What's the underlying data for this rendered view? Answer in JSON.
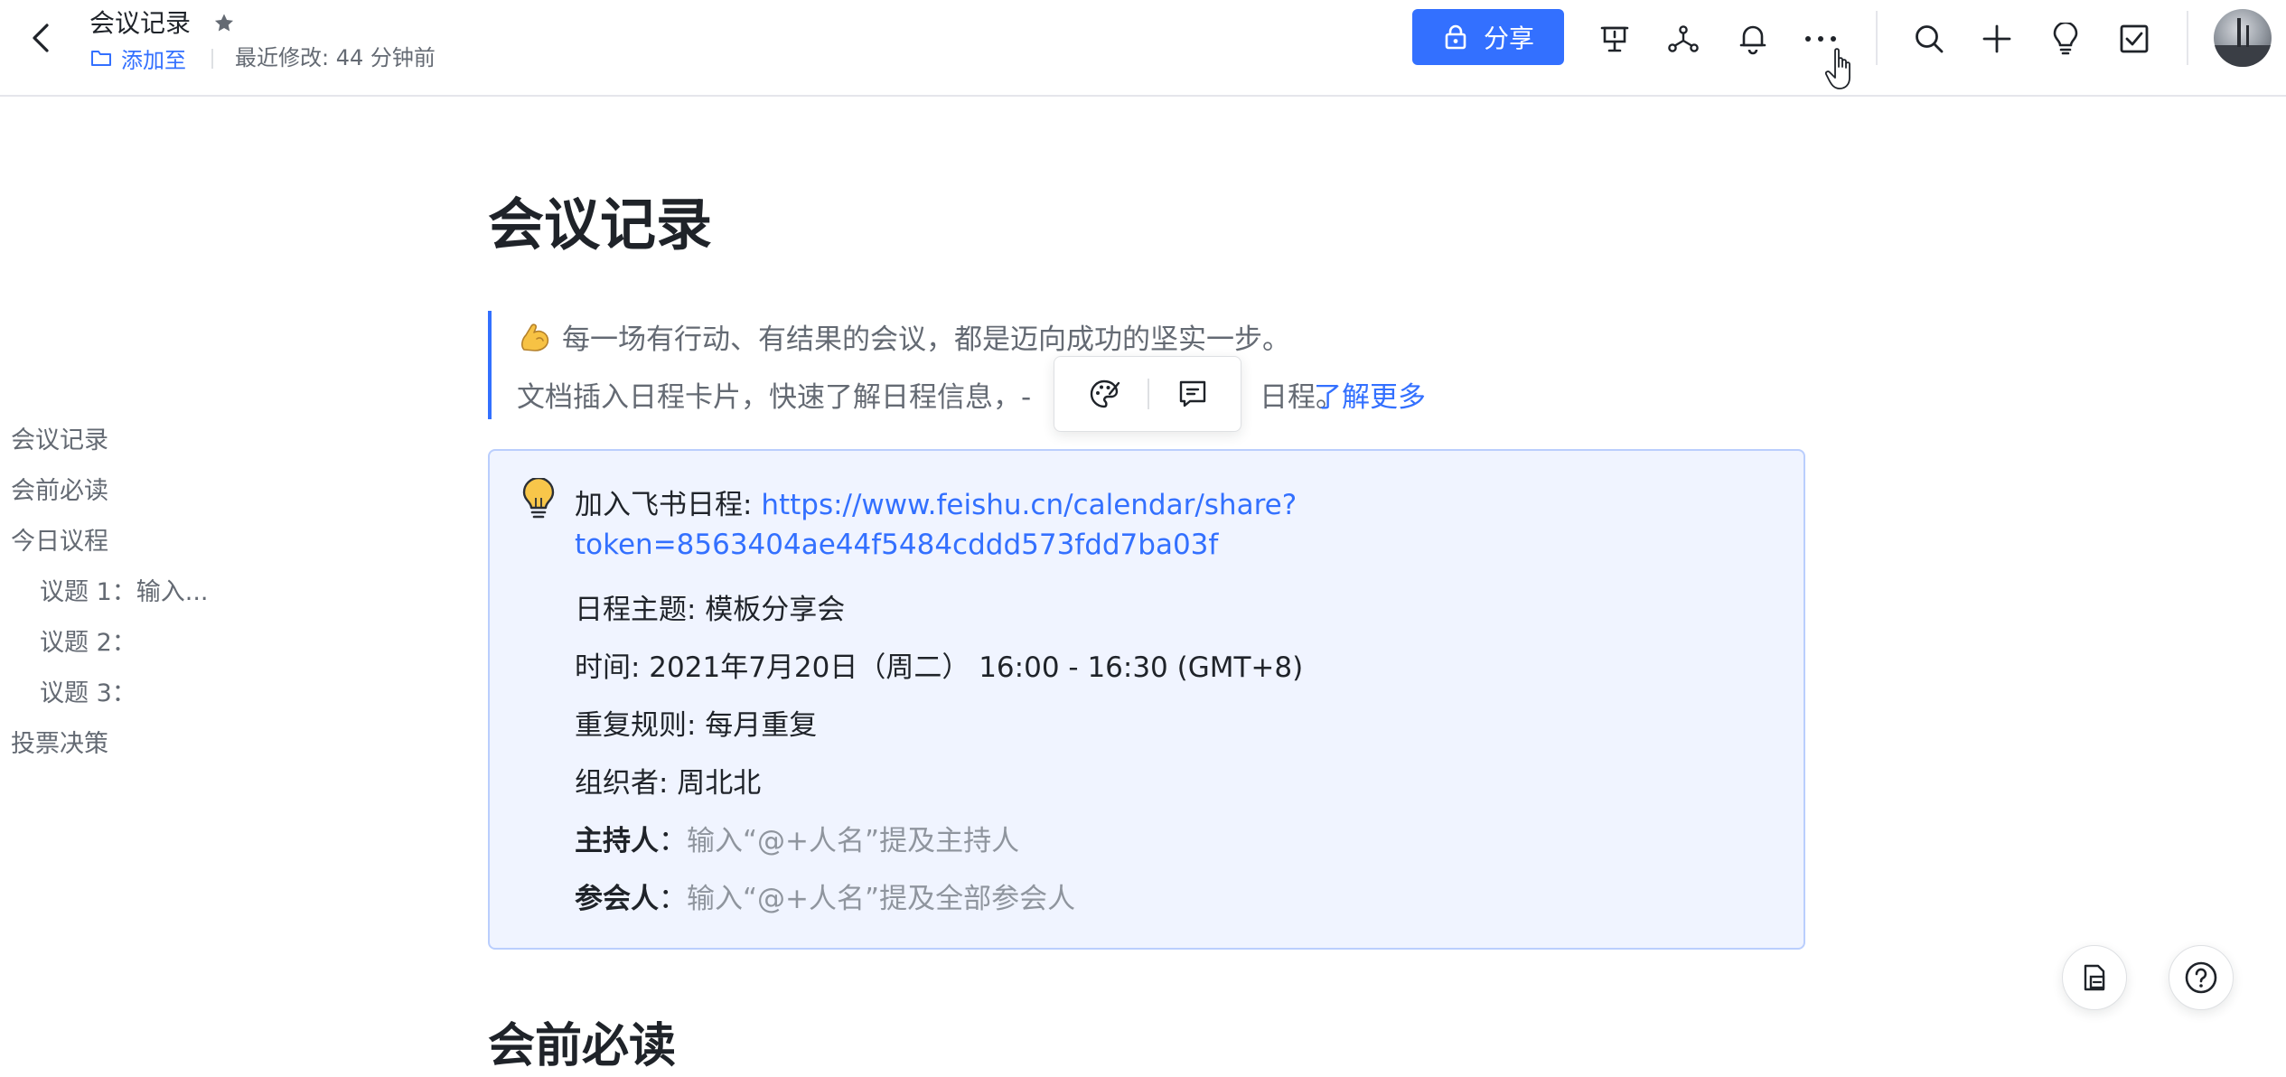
{
  "header": {
    "title": "会议记录",
    "add_to": "添加至",
    "last_modified": "最近修改: 44 分钟前",
    "share_label": "分享"
  },
  "toolbar_icons": [
    "presentation-icon",
    "mindmap-icon",
    "bell-icon",
    "more-icon",
    "search-icon",
    "plus-icon",
    "lightbulb-icon",
    "checkbox-icon"
  ],
  "outline": [
    {
      "label": "会议记录",
      "level": 1
    },
    {
      "label": "会前必读",
      "level": 1
    },
    {
      "label": "今日议程",
      "level": 1
    },
    {
      "label": "议题 1：输入...",
      "level": 2
    },
    {
      "label": "议题 2：",
      "level": 2
    },
    {
      "label": "议题 3：",
      "level": 2
    },
    {
      "label": "投票决策",
      "level": 1
    }
  ],
  "doc": {
    "title": "会议记录",
    "quote_line1": "每一场有行动、有结果的会议，都是迈向成功的坚实一步。",
    "quote_line2_visible": "文档插入日程卡片，快速了解日程信息，-",
    "quote_line2_tail": "日程。",
    "learn_more": "了解更多",
    "callout": {
      "join_label": "加入飞书日程: ",
      "link_line1": "https://www.feishu.cn/calendar/share?",
      "link_line2": "token=8563404ae44f5484cddd573fdd7ba03f",
      "subject": "日程主题: 模板分享会",
      "time": "时间: 2021年7月20日（周二） 16:00 - 16:30 (GMT+8)",
      "repeat": "重复规则: 每月重复",
      "organizer": "组织者: 周北北",
      "host_label": "主持人",
      "host_placeholder": "输入“@+人名”提及主持人",
      "attendees_label": "参会人",
      "attendees_placeholder": "输入“@+人名”提及全部参会人"
    },
    "section2_title": "会前必读"
  },
  "colors": {
    "accent": "#3370ff",
    "callout_bg": "#f0f4ff",
    "callout_border": "#bacefd",
    "text_primary": "#1f2329",
    "text_secondary": "#646a73",
    "placeholder": "#8f959e"
  }
}
